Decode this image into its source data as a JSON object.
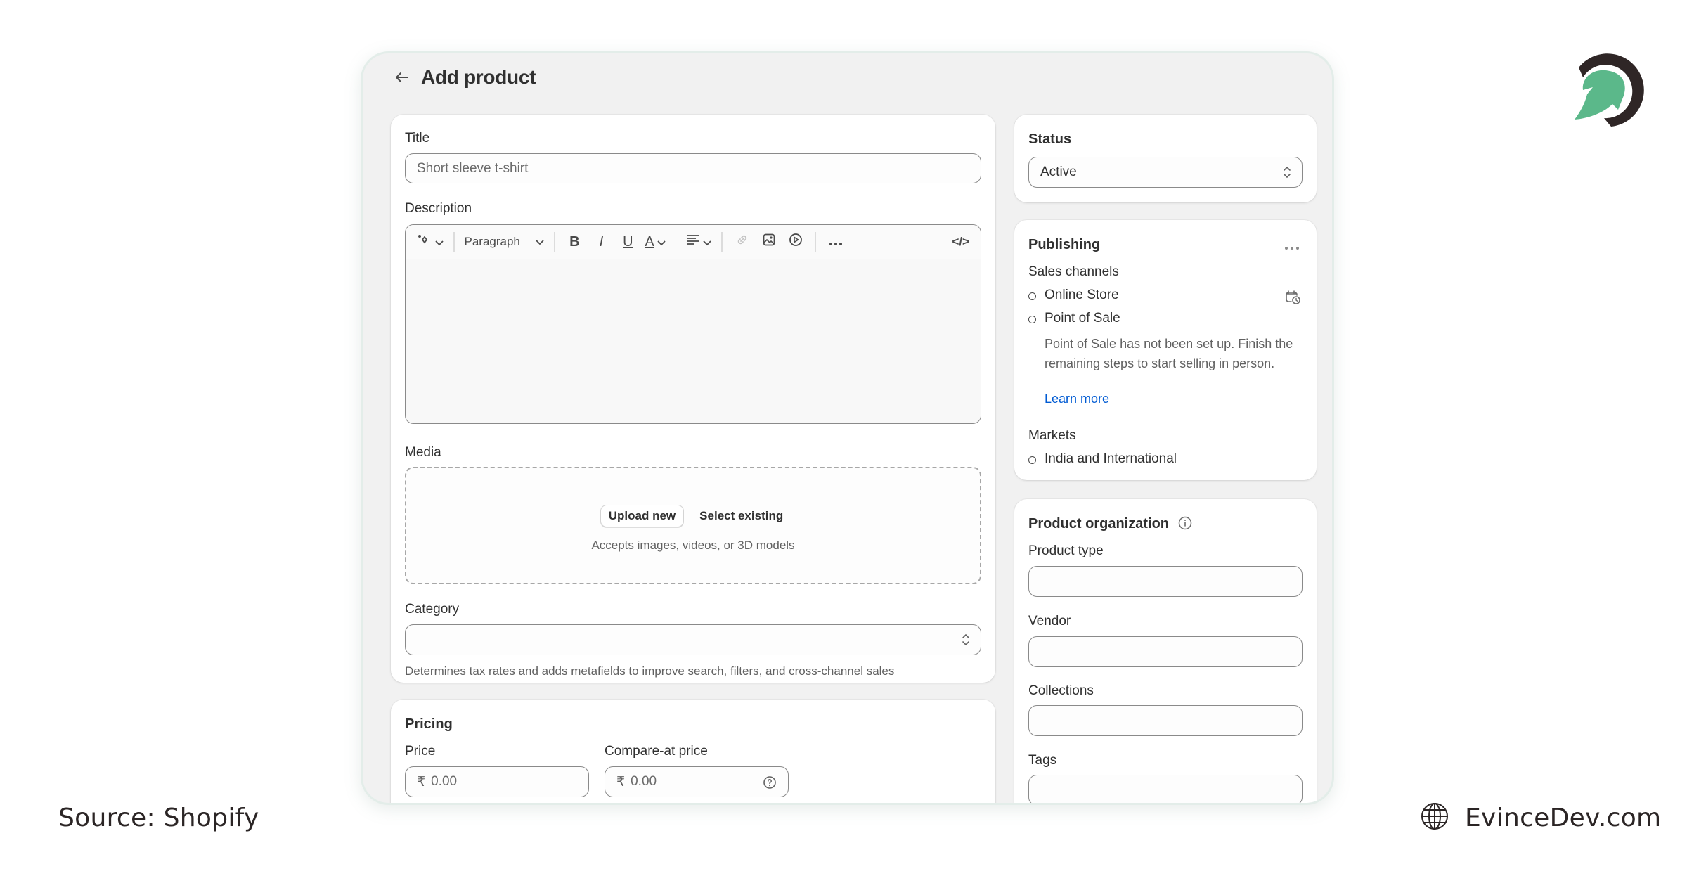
{
  "page": {
    "back_icon": "arrow-left-icon",
    "title": "Add product"
  },
  "main_card": {
    "title_label": "Title",
    "title_placeholder": "Short sleeve t-shirt",
    "description_label": "Description",
    "toolbar": {
      "magic_icon": "sparkle-icon",
      "paragraph_select": "Paragraph",
      "bold": "B",
      "italic": "I",
      "underline": "U",
      "text_color": "A",
      "align_icon": "align-left-icon",
      "link_icon": "link-icon",
      "image_icon": "image-icon",
      "video_icon": "play-circle-icon",
      "more_icon": "more-horizontal-icon",
      "code_label": "</>"
    },
    "media_label": "Media",
    "upload_button": "Upload new",
    "select_existing": "Select existing",
    "media_help": "Accepts images, videos, or 3D models",
    "category_label": "Category",
    "category_value": "",
    "category_help": "Determines tax rates and adds metafields to improve search, filters, and cross-channel sales"
  },
  "pricing": {
    "heading": "Pricing",
    "price_label": "Price",
    "price_currency": "₹",
    "price_placeholder": "0.00",
    "compare_label": "Compare-at price",
    "compare_currency": "₹",
    "compare_placeholder": "0.00",
    "compare_help_icon": "question-circle-icon"
  },
  "status": {
    "heading": "Status",
    "selected": "Active"
  },
  "publishing": {
    "heading": "Publishing",
    "more_icon": "more-horizontal-icon",
    "sales_channels_label": "Sales channels",
    "channels": [
      {
        "name": "Online Store"
      },
      {
        "name": "Point of Sale"
      }
    ],
    "schedule_icon": "calendar-clock-icon",
    "pos_note": "Point of Sale has not been set up. Finish the remaining steps to start selling in person.",
    "learn_more": "Learn more",
    "markets_label": "Markets",
    "markets": [
      {
        "name": "India and International"
      }
    ]
  },
  "organization": {
    "heading": "Product organization",
    "info_icon": "info-circle-icon",
    "fields": [
      {
        "label": "Product type",
        "value": ""
      },
      {
        "label": "Vendor",
        "value": ""
      },
      {
        "label": "Collections",
        "value": ""
      },
      {
        "label": "Tags",
        "value": ""
      }
    ]
  },
  "footer": {
    "source": "Source: Shopify",
    "website": "EvinceDev.com",
    "globe_icon": "globe-icon"
  },
  "brand": {
    "logo": "evincedev-logo",
    "green": "#5bb88a",
    "dark": "#2f2626"
  },
  "colors": {
    "link": "#005bd3",
    "frame_border": "#e3ede9",
    "page_bg": "#f1f1f1"
  }
}
